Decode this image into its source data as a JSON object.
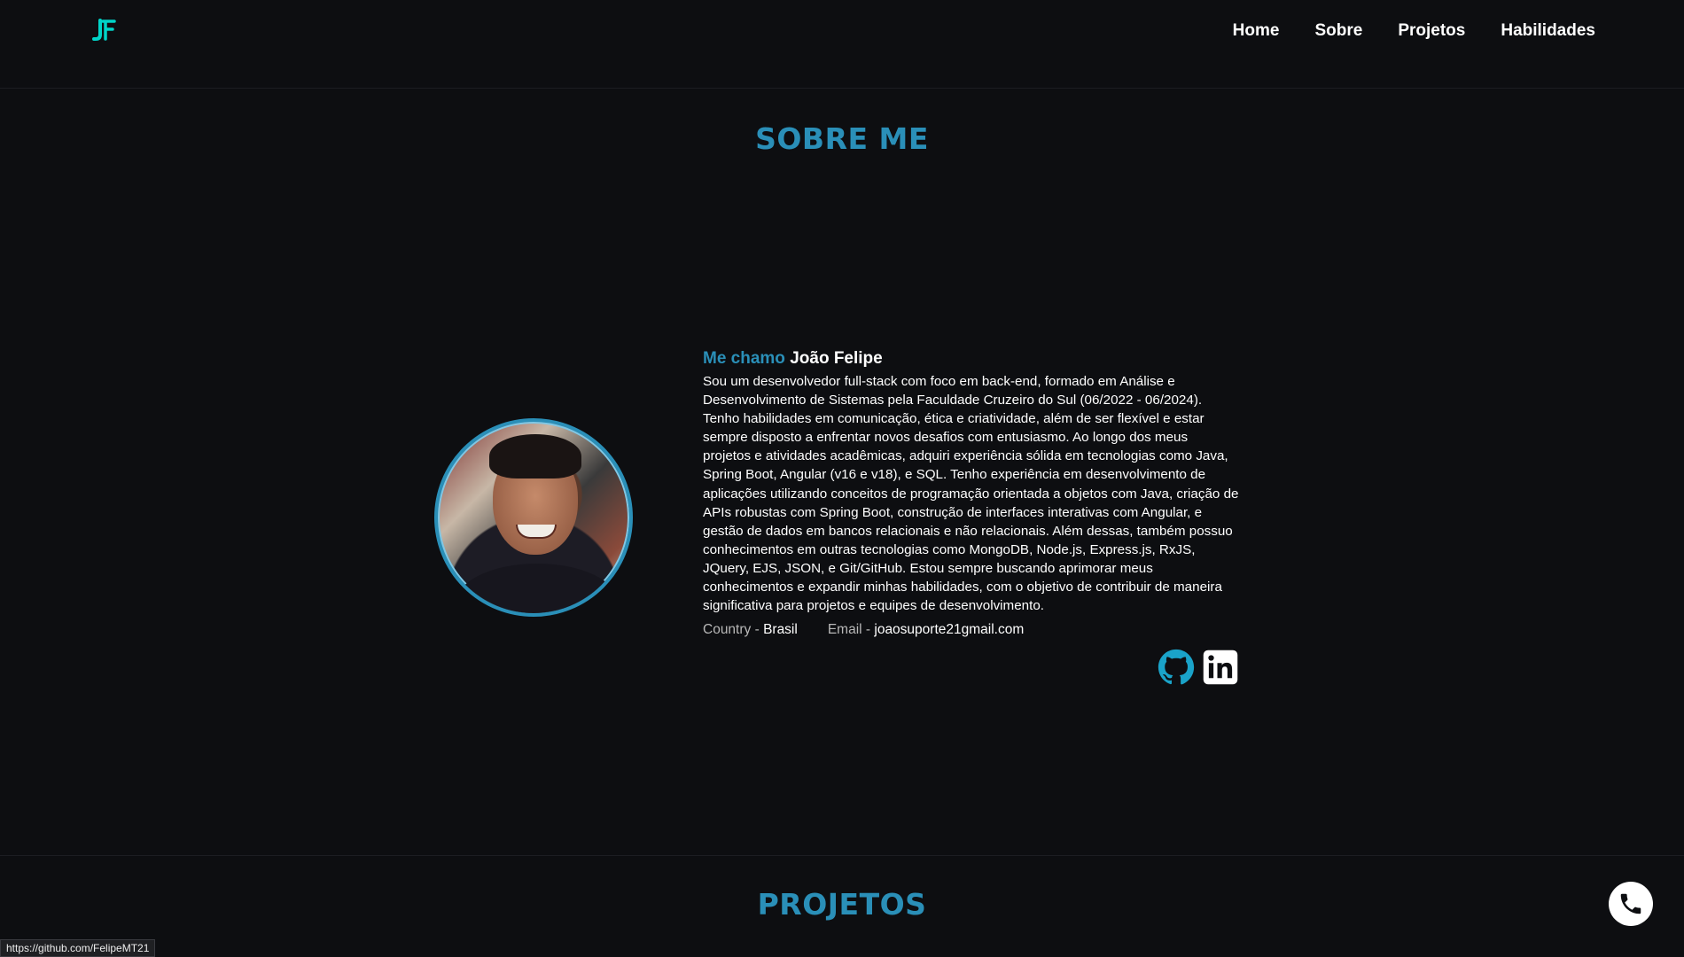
{
  "nav": {
    "logo_text": "JF",
    "links": [
      "Home",
      "Sobre",
      "Projetos",
      "Habilidades"
    ]
  },
  "about": {
    "title": "SOBRE ME",
    "heading_accent": "Me chamo",
    "heading_name": "João Felipe",
    "bio": "Sou um desenvolvedor full-stack com foco em back-end, formado em Análise e Desenvolvimento de Sistemas pela Faculdade Cruzeiro do Sul (06/2022 - 06/2024). Tenho habilidades em comunicação, ética e criatividade, além de ser flexível e estar sempre disposto a enfrentar novos desafios com entusiasmo. Ao longo dos meus projetos e atividades acadêmicas, adquiri experiência sólida em tecnologias como Java, Spring Boot, Angular (v16 e v18), e SQL. Tenho experiência em desenvolvimento de aplicações utilizando conceitos de programação orientada a objetos com Java, criação de APIs robustas com Spring Boot, construção de interfaces interativas com Angular, e gestão de dados em bancos relacionais e não relacionais. Além dessas, também possuo conhecimentos em outras tecnologias como MongoDB, Node.js, Express.js, RxJS, JQuery, EJS, JSON, e Git/GitHub. Estou sempre buscando aprimorar meus conhecimentos e expandir minhas habilidades, com o objetivo de contribuir de maneira significativa para projetos e equipes de desenvolvimento.",
    "country_label": "Country -",
    "country_value": "Brasil",
    "email_label": "Email -",
    "email_value": "joaosuporte21gmail.com",
    "social_icons": [
      "github-icon",
      "linkedin-icon"
    ]
  },
  "projects": {
    "title": "PROJETOS"
  },
  "status_url": "https://github.com/FelipeMT21",
  "colors": {
    "accent": "#2a8fb8",
    "logo": "#00d4c8",
    "background": "#0d0e11"
  }
}
